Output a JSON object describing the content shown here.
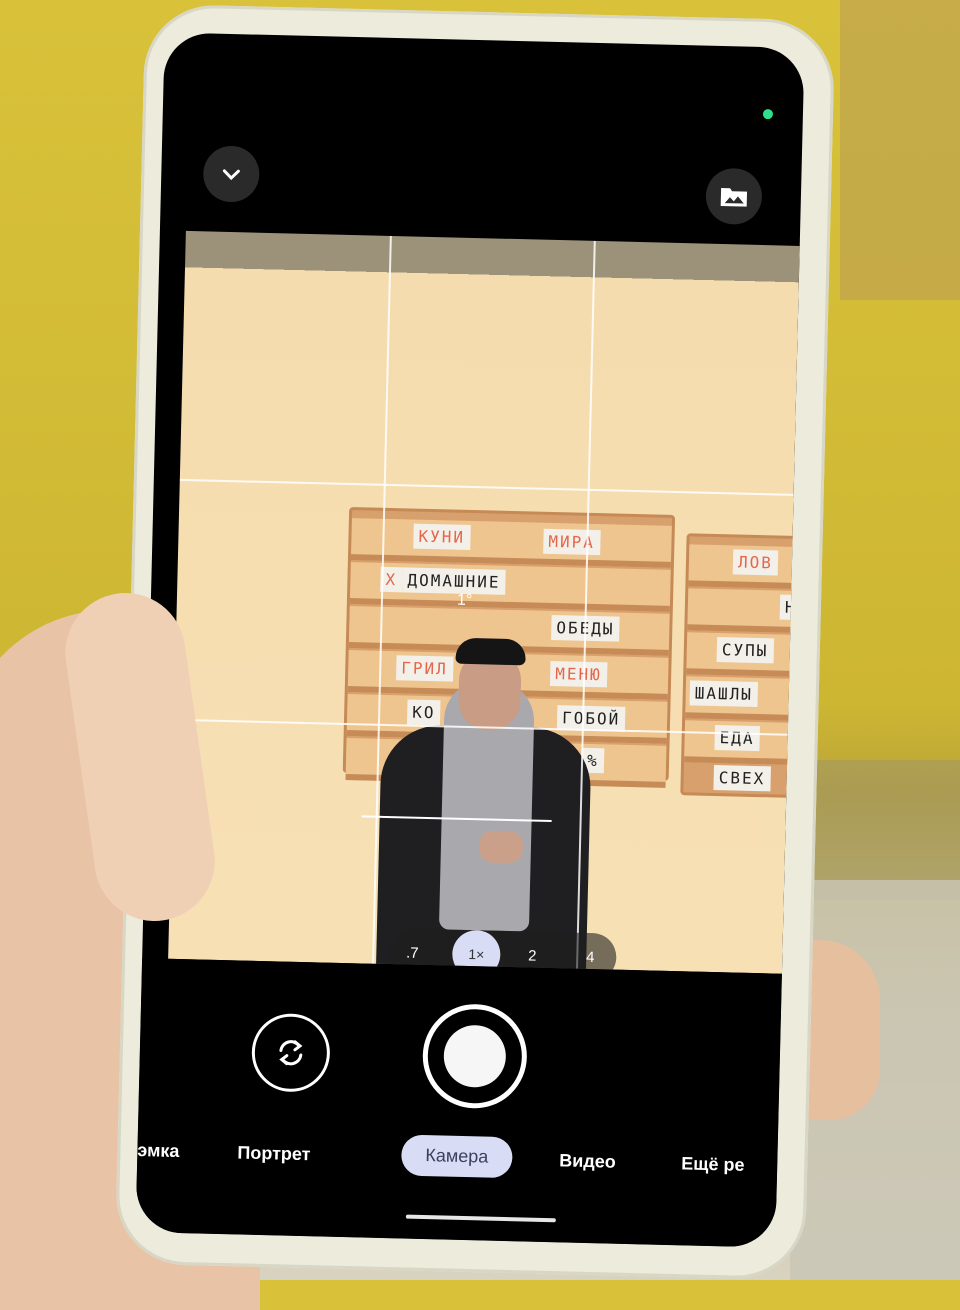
{
  "colors": {
    "accent": "#d8dcf4",
    "status_dot": "#2fe08a",
    "screen_bg": "#000000"
  },
  "top_bar": {
    "collapse_icon": "chevron-down-icon",
    "gallery_icon": "gallery-icon"
  },
  "viewfinder": {
    "level_readout": "1°",
    "board_left_words": [
      "КУНИ",
      "МИРА",
      "Х",
      "ДОМАШНИЕ",
      "ОБЕДЫ",
      "ГРИЛ",
      "МЕНЮ",
      "КО",
      "ГОБОЙ",
      "%"
    ],
    "board_right_words": [
      "ЛОВ",
      "Н",
      "СУПЫ",
      "ШАШЛЫ",
      "ЕДА",
      "СВЕХ"
    ]
  },
  "zoom": {
    "options": [
      ".7",
      "1×",
      "2",
      "4"
    ],
    "selected": "1×"
  },
  "modes": {
    "items": [
      "эмка",
      "Портрет",
      "Камера",
      "Видео",
      "Ещё ре"
    ],
    "selected": "Камера"
  },
  "controls": {
    "switch_icon": "camera-switch-icon",
    "shutter_icon": "shutter-icon"
  }
}
